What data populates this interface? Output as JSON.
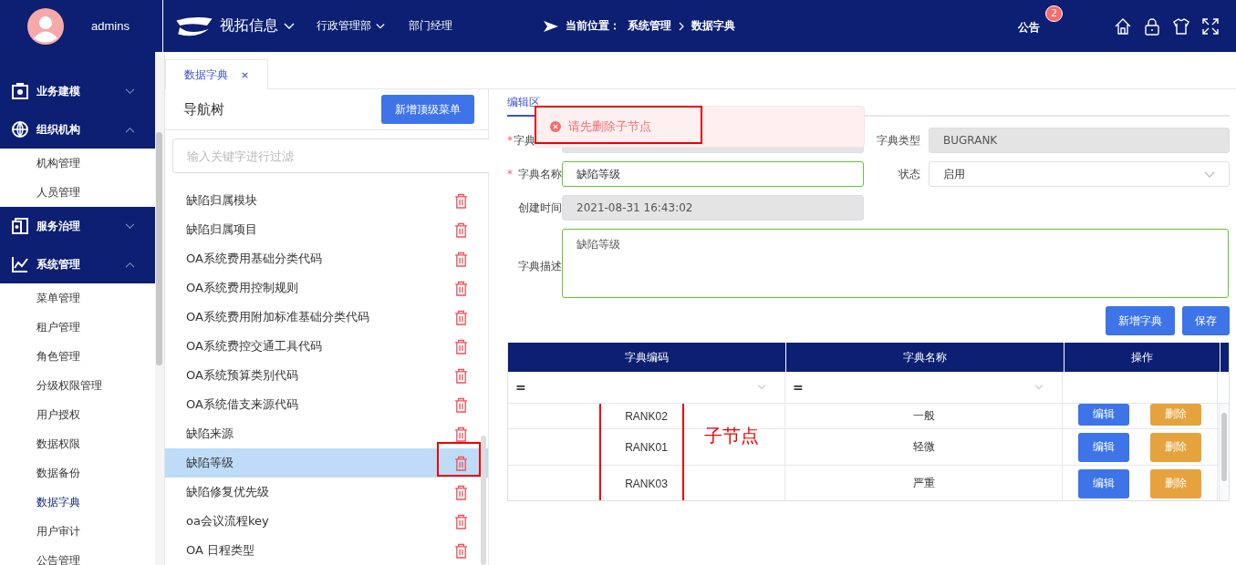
{
  "header": {
    "user": "admins",
    "brand": "视拓信息",
    "department": "行政管理部",
    "role": "部门经理",
    "breadcrumb_label": "当前位置：",
    "breadcrumb": [
      "系统管理",
      "数据字典"
    ],
    "notice": "公告",
    "notice_count": "2"
  },
  "sidebar": [
    {
      "label": "业务建模",
      "expanded": false
    },
    {
      "label": "组织机构",
      "expanded": true,
      "children": [
        {
          "label": "机构管理",
          "selected": false
        },
        {
          "label": "人员管理",
          "selected": false
        }
      ]
    },
    {
      "label": "服务治理",
      "expanded": false
    },
    {
      "label": "系统管理",
      "expanded": true,
      "children": [
        {
          "label": "菜单管理",
          "selected": false
        },
        {
          "label": "租户管理",
          "selected": false
        },
        {
          "label": "角色管理",
          "selected": false
        },
        {
          "label": "分级权限管理",
          "selected": false
        },
        {
          "label": "用户授权",
          "selected": false
        },
        {
          "label": "数据权限",
          "selected": false
        },
        {
          "label": "数据备份",
          "selected": false
        },
        {
          "label": "数据字典",
          "selected": true
        },
        {
          "label": "用户审计",
          "selected": false
        },
        {
          "label": "公告管理",
          "selected": false
        }
      ]
    }
  ],
  "tabs": [
    {
      "label": "数据字典",
      "selected": true
    }
  ],
  "tree": {
    "title": "导航树",
    "add_button": "新增顶级菜单",
    "filter_placeholder": "输入关键字进行过滤",
    "items": [
      {
        "label": "缺陷归属模块",
        "selected": false
      },
      {
        "label": "缺陷归属项目",
        "selected": false
      },
      {
        "label": "OA系统费用基础分类代码",
        "selected": false
      },
      {
        "label": "OA系统费用控制规则",
        "selected": false
      },
      {
        "label": "OA系统费用附加标准基础分类代码",
        "selected": false
      },
      {
        "label": "OA系统费控交通工具代码",
        "selected": false
      },
      {
        "label": "OA系统预算类别代码",
        "selected": false
      },
      {
        "label": "OA系统借支来源代码",
        "selected": false
      },
      {
        "label": "缺陷来源",
        "selected": false
      },
      {
        "label": "缺陷等级",
        "selected": true
      },
      {
        "label": "缺陷修复优先级",
        "selected": false
      },
      {
        "label": "oa会议流程key",
        "selected": false
      },
      {
        "label": "OA 日程类型",
        "selected": false
      }
    ]
  },
  "editor": {
    "tab": "编辑区",
    "toast": "请先删除子节点",
    "required_mark": "*",
    "code_label": "字典",
    "type_label": "字典类型",
    "type_value": "BUGRANK",
    "name_required_mark": "*",
    "name_label": "字典名称",
    "name_value": "缺陷等级",
    "status_label": "状态",
    "status_value": "启用",
    "created_label": "创建时间",
    "created_value": "2021-08-31 16:43:02",
    "desc_label": "字典描述",
    "desc_value": "缺陷等级",
    "buttons": [
      "新增字典",
      "保存"
    ]
  },
  "table": {
    "columns": [
      "字典编码",
      "字典名称",
      "操作"
    ],
    "filters": [
      "=",
      "="
    ],
    "rows": [
      {
        "code": "RANK02",
        "name": "一般",
        "actions": [
          "编辑",
          "删除"
        ]
      },
      {
        "code": "RANK01",
        "name": "轻微",
        "actions": [
          "编辑",
          "删除"
        ]
      },
      {
        "code": "RANK03",
        "name": "严重",
        "actions": [
          "编辑",
          "删除"
        ]
      }
    ]
  },
  "annotation": "子节点"
}
